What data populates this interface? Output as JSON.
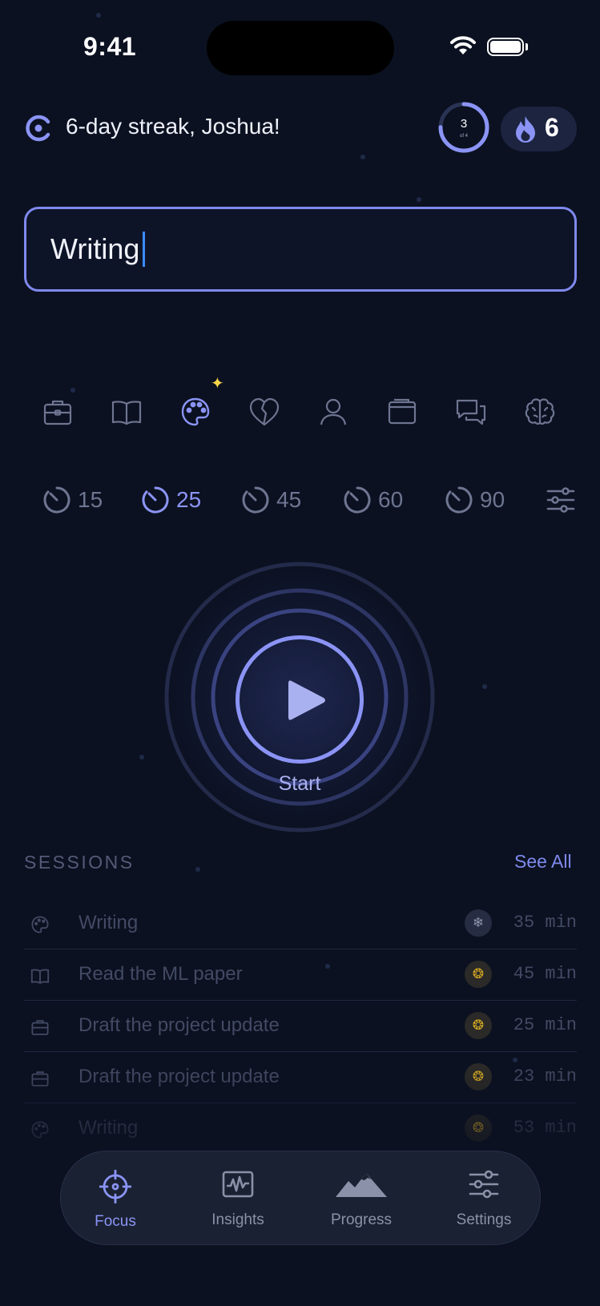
{
  "status_bar": {
    "time": "9:41"
  },
  "header": {
    "streak_text": "6-day streak, Joshua!",
    "goal_progress": {
      "done": "3",
      "total_label": "of 4",
      "fraction": 0.75
    },
    "streak_count": "6"
  },
  "task_input": {
    "value": "Writing"
  },
  "categories": [
    {
      "icon": "briefcase-icon",
      "selected": false
    },
    {
      "icon": "book-icon",
      "selected": false
    },
    {
      "icon": "palette-icon",
      "selected": true
    },
    {
      "icon": "heart-icon",
      "selected": false
    },
    {
      "icon": "person-icon",
      "selected": false
    },
    {
      "icon": "wallet-icon",
      "selected": false
    },
    {
      "icon": "chat-icon",
      "selected": false
    },
    {
      "icon": "brain-icon",
      "selected": false
    }
  ],
  "durations": [
    {
      "label": "15",
      "selected": false
    },
    {
      "label": "25",
      "selected": true
    },
    {
      "label": "45",
      "selected": false
    },
    {
      "label": "60",
      "selected": false
    },
    {
      "label": "90",
      "selected": false
    }
  ],
  "start": {
    "label": "Start"
  },
  "sessions": {
    "title": "SESSIONS",
    "see_all": "See All",
    "items": [
      {
        "icon": "palette-icon",
        "name": "Writing",
        "badge": "snowflake-badge",
        "minutes": "35 min"
      },
      {
        "icon": "book-icon",
        "name": "Read the ML paper",
        "badge": "gold-badge",
        "minutes": "45 min"
      },
      {
        "icon": "briefcase-icon",
        "name": "Draft the project update",
        "badge": "gold-badge",
        "minutes": "25 min"
      },
      {
        "icon": "briefcase-icon",
        "name": "Draft the project update",
        "badge": "gold-badge",
        "minutes": "23 min"
      },
      {
        "icon": "palette-icon",
        "name": "Writing",
        "badge": "gold-badge",
        "minutes": "53 min"
      }
    ]
  },
  "tabbar": {
    "tabs": [
      {
        "label": "Focus",
        "icon": "crosshair-icon",
        "active": true
      },
      {
        "label": "Insights",
        "icon": "pulse-chart-icon",
        "active": false
      },
      {
        "label": "Progress",
        "icon": "mountains-icon",
        "active": false
      },
      {
        "label": "Settings",
        "icon": "sliders-icon",
        "active": false
      }
    ]
  },
  "colors": {
    "background": "#0b1120",
    "accent": "#8b94f5",
    "gold": "#d4a824"
  }
}
